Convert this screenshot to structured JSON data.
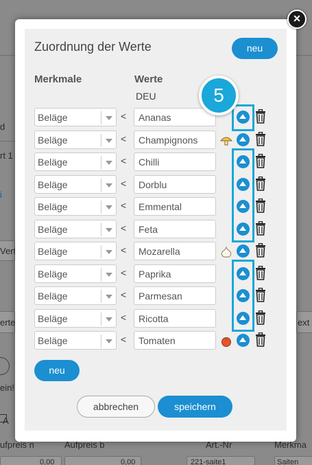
{
  "background": {
    "top_text": "",
    "fragments": [
      {
        "id": "bg-d",
        "text": "d"
      },
      {
        "id": "bg-rt",
        "text": "rt 1"
      },
      {
        "id": "bg-i",
        "text": "i"
      },
      {
        "id": "bg-vert",
        "text": "Vert"
      },
      {
        "id": "bg-erte",
        "text": "erte"
      },
      {
        "id": "bg-ext",
        "text": "ext"
      },
      {
        "id": "bg-ein",
        "text": "ein!"
      },
      {
        "id": "bg-a",
        "text": "A"
      },
      {
        "id": "bg-aufpreis-n",
        "text": "ufpreis n"
      },
      {
        "id": "bg-aufpreis-b",
        "text": "Aufpreis b"
      },
      {
        "id": "bg-artnr",
        "text": "Art.-Nr"
      },
      {
        "id": "bg-merkma",
        "text": "Merkma"
      },
      {
        "id": "bg-val1",
        "text": "0,00"
      },
      {
        "id": "bg-val2",
        "text": "0,00"
      },
      {
        "id": "bg-saite",
        "text": "221-saite1"
      },
      {
        "id": "bg-saiten",
        "text": "Saiten"
      }
    ]
  },
  "dialog": {
    "title": "Zuordnung der Werte",
    "new_top_label": "neu",
    "new_bottom_label": "neu",
    "cancel_label": "abbrechen",
    "save_label": "speichern",
    "close_symbol": "×",
    "col_features": "Merkmale",
    "col_values": "Werte",
    "language": "DEU",
    "separator": "<",
    "rows": [
      {
        "feature": "Beläge",
        "value": "Ananas",
        "icon": ""
      },
      {
        "feature": "Beläge",
        "value": "Champignons",
        "icon": "mushroom-icon"
      },
      {
        "feature": "Beläge",
        "value": "Chilli",
        "icon": ""
      },
      {
        "feature": "Beläge",
        "value": "Dorblu",
        "icon": ""
      },
      {
        "feature": "Beläge",
        "value": "Emmental",
        "icon": ""
      },
      {
        "feature": "Beläge",
        "value": "Feta",
        "icon": ""
      },
      {
        "feature": "Beläge",
        "value": "Mozarella",
        "icon": "garlic-icon"
      },
      {
        "feature": "Beläge",
        "value": "Paprika",
        "icon": ""
      },
      {
        "feature": "Beläge",
        "value": "Parmesan",
        "icon": ""
      },
      {
        "feature": "Beläge",
        "value": "Ricotta",
        "icon": ""
      },
      {
        "feature": "Beläge",
        "value": "Tomaten",
        "icon": "tomato-icon"
      }
    ]
  },
  "callout": {
    "number": "5",
    "color": "#1aa7d9"
  },
  "colors": {
    "accent": "#1b8fd1"
  }
}
